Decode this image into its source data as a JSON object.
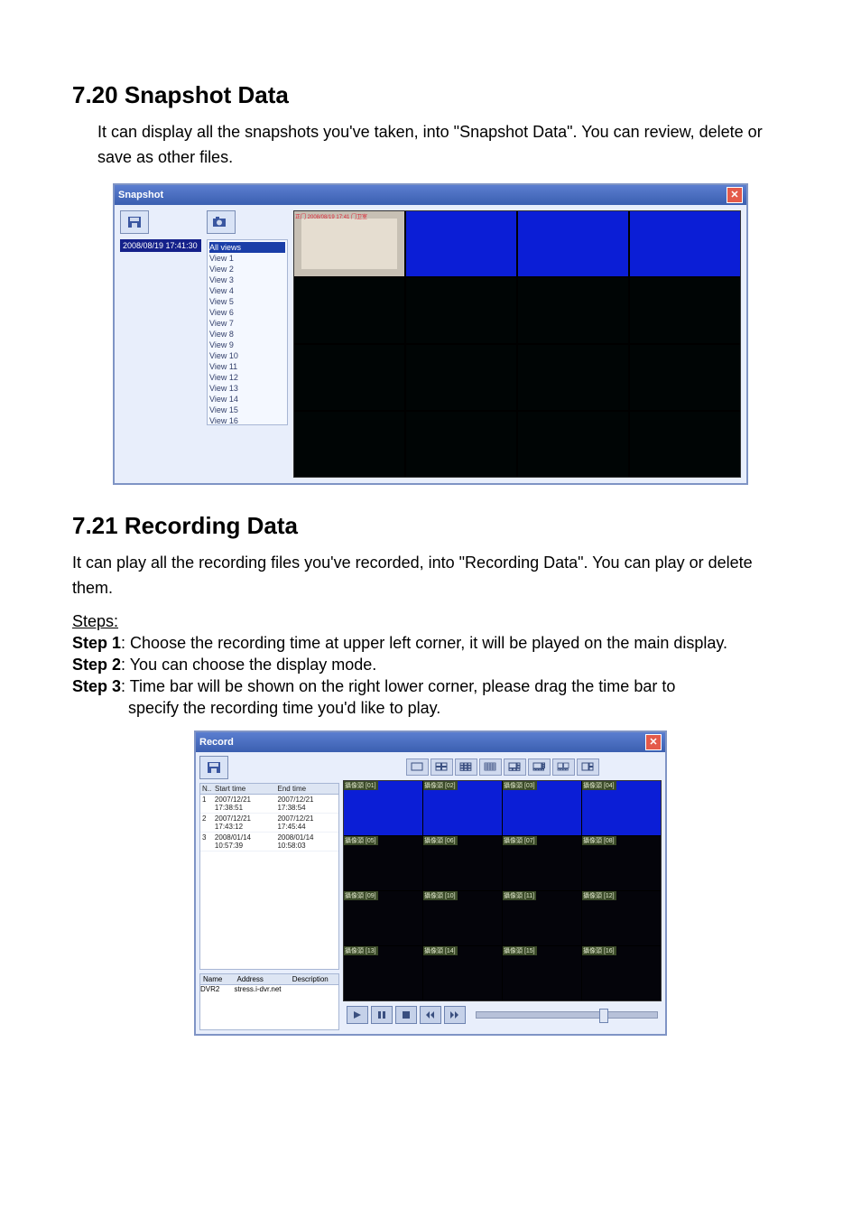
{
  "section1": {
    "heading": "7.20 Snapshot Data",
    "para": "It can display all the snapshots you've taken, into \"Snapshot Data\". You can review, delete or save as other files."
  },
  "snapshot_window": {
    "title": "Snapshot",
    "timestamp": "2008/08/19 17:41:30",
    "views_first": "All views",
    "views": [
      "View 1",
      "View 2",
      "View 3",
      "View 4",
      "View 5",
      "View 6",
      "View 7",
      "View 8",
      "View 9",
      "View 10",
      "View 11",
      "View 12",
      "View 13",
      "View 14",
      "View 15",
      "View 16"
    ],
    "cell_labels": [
      "正门 2008/08/19 17:41 门卫室",
      "",
      "",
      "",
      "",
      "",
      "",
      "",
      "",
      "",
      "",
      "",
      "",
      "",
      "",
      ""
    ]
  },
  "section2": {
    "heading": "7.21 Recording Data",
    "para": "It can play all the recording files you've recorded, into \"Recording Data\". You can play or delete them."
  },
  "steps": {
    "label": "Steps:",
    "s1b": "Step 1",
    "s1t": ": Choose the recording time at upper left corner, it will be played on the main display.",
    "s2b": "Step 2",
    "s2t": ": You can choose the display mode.",
    "s3b": "Step 3",
    "s3t": ": Time bar will be shown on the right lower corner, please drag the time bar to",
    "s3t2": "specify the recording time you'd like to play."
  },
  "record_window": {
    "title": "Record",
    "table_headers": {
      "n": "N..",
      "s": "Start time",
      "e": "End time"
    },
    "rows": [
      {
        "n": "1",
        "s": "2007/12/21 17:38:51",
        "e": "2007/12/21 17:38:54"
      },
      {
        "n": "2",
        "s": "2007/12/21 17:43:12",
        "e": "2007/12/21 17:45:44"
      },
      {
        "n": "3",
        "s": "2008/01/14 10:57:39",
        "e": "2008/01/14 10:58:03"
      }
    ],
    "lower_headers": {
      "a": "Name",
      "b": "Address",
      "c": "Description"
    },
    "lower_row": {
      "a": "DVR2",
      "b": "stress.i-dvr.net",
      "c": ""
    },
    "tags": [
      "攝像頭 [01]",
      "攝像頭 [02]",
      "攝像頭 [03]",
      "攝像頭 [04]",
      "攝像頭 [05]",
      "攝像頭 [06]",
      "攝像頭 [07]",
      "攝像頭 [08]",
      "攝像頭 [09]",
      "攝像頭 [10]",
      "攝像頭 [11]",
      "攝像頭 [12]",
      "攝像頭 [13]",
      "攝像頭 [14]",
      "攝像頭 [15]",
      "攝像頭 [16]"
    ]
  }
}
